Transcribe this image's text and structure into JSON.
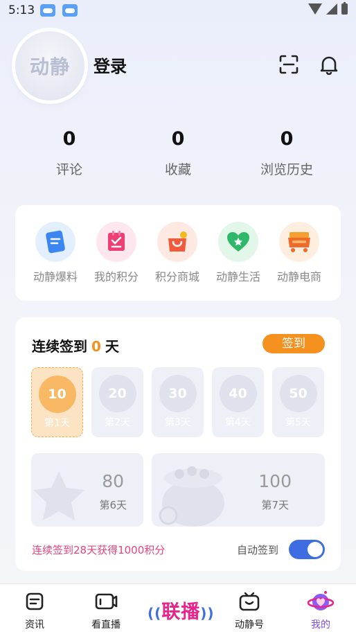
{
  "status_bar": {
    "time": "5:13"
  },
  "profile": {
    "avatar_text": "动静",
    "login_label": "登录"
  },
  "stats": [
    {
      "value": "0",
      "label": "评论"
    },
    {
      "value": "0",
      "label": "收藏"
    },
    {
      "value": "0",
      "label": "浏览历史"
    }
  ],
  "services": [
    {
      "label": "动静爆料",
      "icon": "note-icon"
    },
    {
      "label": "我的积分",
      "icon": "points-icon"
    },
    {
      "label": "积分商城",
      "icon": "shopping-bag-icon"
    },
    {
      "label": "动静生活",
      "icon": "heart-icon"
    },
    {
      "label": "动静电商",
      "icon": "cart-icon"
    }
  ],
  "checkin": {
    "title_prefix": "连续签到",
    "days_count": "0",
    "title_suffix": "天",
    "sign_button": "签到",
    "days": [
      {
        "points": "10",
        "label": "第1天"
      },
      {
        "points": "20",
        "label": "第2天"
      },
      {
        "points": "30",
        "label": "第3天"
      },
      {
        "points": "40",
        "label": "第4天"
      },
      {
        "points": "50",
        "label": "第5天"
      },
      {
        "points": "80",
        "label": "第6天"
      },
      {
        "points": "100",
        "label": "第7天"
      }
    ],
    "reward_text": "连续签到28天获得1000积分",
    "auto_label": "自动签到",
    "auto_enabled": true
  },
  "tabbar": {
    "tabs": [
      {
        "label": "资讯"
      },
      {
        "label": "看直播"
      },
      {
        "label": "联播"
      },
      {
        "label": "动静号"
      },
      {
        "label": "我的"
      }
    ]
  },
  "colors": {
    "accent_orange": "#f5911e",
    "accent_blue": "#3d6de0",
    "reward_pink": "#e8427a",
    "selected_tab": "#7a4cf0"
  }
}
